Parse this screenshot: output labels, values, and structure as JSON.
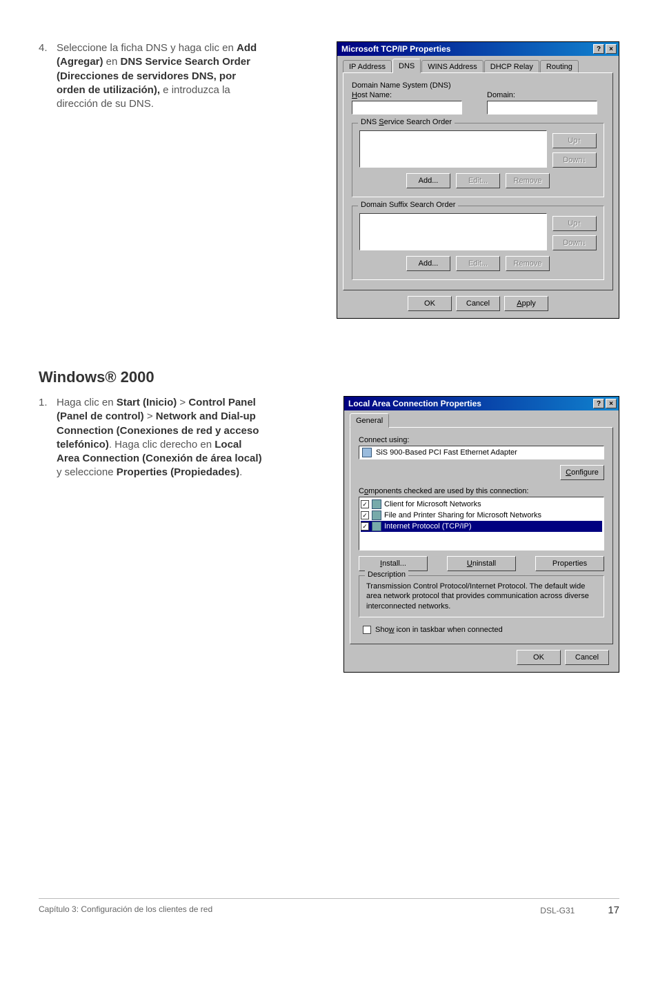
{
  "step4": {
    "number": "4.",
    "text_before_add": "Seleccione la ficha DNS y haga clic en ",
    "add_label": "Add (Agregar)",
    "text_middle_1": " en ",
    "dns_label": "DNS Service Search Order (Direcciones de servidores DNS, por orden de utilización),",
    "text_after": " e introduzca la dirección de su DNS."
  },
  "dialog1": {
    "title": "Microsoft TCP/IP Properties",
    "help_glyph": "?",
    "close_glyph": "×",
    "tabs": [
      "IP Address",
      "DNS",
      "WINS Address",
      "DHCP Relay",
      "Routing"
    ],
    "active_tab_index": 1,
    "dns_system_label": "Domain Name System (DNS)",
    "host_label_pre": "H",
    "host_label_rest": "ost Name:",
    "domain_label_pre": "D",
    "domain_label_rest": "omain:",
    "svc_order_label_pre": "DNS ",
    "svc_order_label_u": "S",
    "svc_order_label_post": "ervice Search Order",
    "suffix_order_label": "Domain Suffix Search Order",
    "btn_up": "Up↑",
    "btn_down": "Down↓",
    "btn_add": "Add...",
    "btn_edit": "Edit...",
    "btn_remove": "Remove",
    "ok": "OK",
    "cancel": "Cancel",
    "apply_pre": "A",
    "apply_rest": "pply"
  },
  "section_heading": "Windows® 2000",
  "step1": {
    "number": "1.",
    "t1": "Haga clic en ",
    "b1": "Start (Inicio)",
    "sep1": " > ",
    "b2": "Control Panel (Panel de control)",
    "sep2": " > ",
    "b3": "Network and Dial-up Connection (Conexiones de red y acceso telefónico)",
    "t2": ". Haga clic derecho en ",
    "b4": "Local Area Connection (Conexión de área local)",
    "t3": " y seleccione ",
    "b5": "Properties (Propiedades)",
    "t4": "."
  },
  "dialog2": {
    "title": "Local Area Connection Properties",
    "help_glyph": "?",
    "close_glyph": "×",
    "tab_general": "General",
    "connect_using": "Connect using:",
    "adapter": "SiS 900-Based PCI Fast Ethernet Adapter",
    "configure_u": "C",
    "configure_rest": "onfigure",
    "components_label_pre": "C",
    "components_label_u": "o",
    "components_label_post": "mponents checked are used by this connection:",
    "items": [
      {
        "checked": true,
        "label": "Client for Microsoft Networks"
      },
      {
        "checked": true,
        "label": "File and Printer Sharing for Microsoft Networks"
      },
      {
        "checked": true,
        "label": "Internet Protocol (TCP/IP)",
        "selected": true
      }
    ],
    "install_u": "I",
    "install_rest": "nstall...",
    "uninstall_u": "U",
    "uninstall_rest": "ninstall",
    "properties_u": "P",
    "properties_rest": "roperties",
    "desc_legend": "Description",
    "desc_text": "Transmission Control Protocol/Internet Protocol. The default wide area network protocol that provides communication across diverse interconnected networks.",
    "show_icon_pre": "Sho",
    "show_icon_u": "w",
    "show_icon_post": " icon in taskbar when connected",
    "ok": "OK",
    "cancel": "Cancel"
  },
  "footer": {
    "left": "Capítulo 3: Configuración de los clientes de red",
    "model": "DSL-G31",
    "page": "17"
  }
}
